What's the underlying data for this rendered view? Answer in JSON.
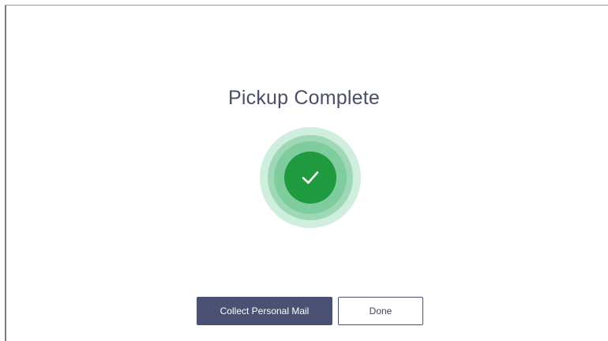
{
  "screen": {
    "title": "Pickup Complete",
    "status_icon": "checkmark-icon",
    "colors": {
      "accent": "#1f9a3f",
      "ring_outer": "#cfeedd",
      "ring_mid": "#9fd8b6",
      "ring_inner": "#7fcd9e",
      "primary_button": "#4a5173",
      "title_text": "#4a4f68"
    }
  },
  "actions": {
    "collect_label": "Collect Personal Mail",
    "done_label": "Done"
  }
}
